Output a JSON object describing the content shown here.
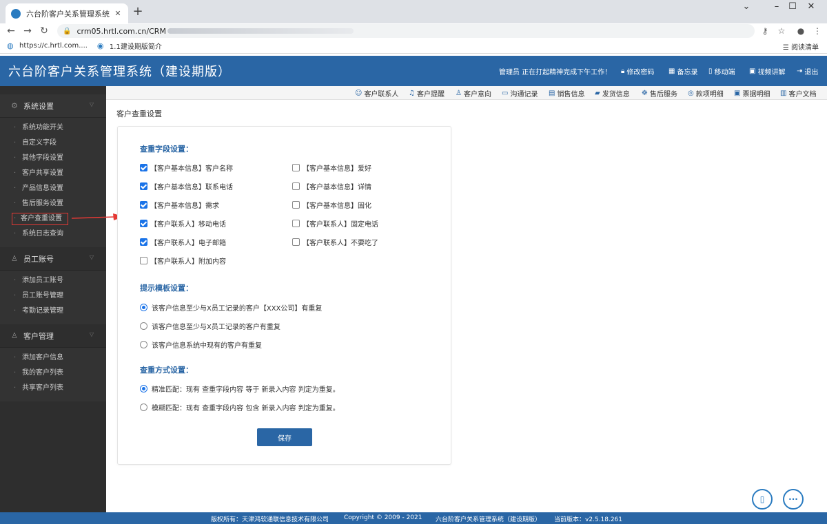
{
  "browser": {
    "tab_title": "六台阶客户关系管理系统（建设期",
    "url": "crm05.hrtl.com.cn/CRM",
    "bookmarks": [
      "https://c.hrtl.com....",
      "1.1建设期版简介"
    ],
    "reading_list": "阅读清单"
  },
  "header": {
    "title": "六台阶客户关系管理系统（建设期版）",
    "status": "管理员 正在打起精神完成下午工作！",
    "links": [
      "修改密码",
      "备忘录",
      "移动端",
      "视频讲解",
      "退出"
    ]
  },
  "sidebar": {
    "groups": [
      {
        "label": "系统设置",
        "items": [
          "系统功能开关",
          "自定义字段",
          "其他字段设置",
          "客户共享设置",
          "产品信息设置",
          "售后服务设置",
          "客户查重设置",
          "系统日志查询"
        ]
      },
      {
        "label": "员工账号",
        "items": [
          "添加员工账号",
          "员工账号管理",
          "考勤记录管理"
        ]
      },
      {
        "label": "客户管理",
        "items": [
          "添加客户信息",
          "我的客户列表",
          "共享客户列表"
        ]
      }
    ]
  },
  "shortcuts": [
    "客户联系人",
    "客户提醒",
    "客户意向",
    "沟通记录",
    "销售信息",
    "发货信息",
    "售后服务",
    "款项明细",
    "票据明细",
    "客户文档"
  ],
  "page_title": "客户查重设置",
  "dup_fields": {
    "title": "查重字段设置：",
    "options": [
      {
        "label": "【客户基本信息】客户名称",
        "checked": true
      },
      {
        "label": "【客户基本信息】爱好",
        "checked": false
      },
      {
        "label": "【客户基本信息】联系电话",
        "checked": true
      },
      {
        "label": "【客户基本信息】详情",
        "checked": false
      },
      {
        "label": "【客户基本信息】需求",
        "checked": true
      },
      {
        "label": "【客户基本信息】固化",
        "checked": false
      },
      {
        "label": "【客户联系人】移动电话",
        "checked": true
      },
      {
        "label": "【客户联系人】固定电话",
        "checked": false
      },
      {
        "label": "【客户联系人】电子邮箱",
        "checked": true
      },
      {
        "label": "【客户联系人】不要吃了",
        "checked": false
      },
      {
        "label": "【客户联系人】附加内容",
        "checked": false
      }
    ]
  },
  "prompt_template": {
    "title": "提示模板设置：",
    "options": [
      {
        "label": "该客户信息至少与X员工记录的客户【XXX公司】有重复",
        "selected": true
      },
      {
        "label": "该客户信息至少与X员工记录的客户有重复",
        "selected": false
      },
      {
        "label": "该客户信息系统中现有的客户有重复",
        "selected": false
      }
    ]
  },
  "match_mode": {
    "title": "查重方式设置：",
    "options": [
      {
        "label": "精准匹配：现有 查重字段内容 等于 新录入内容 判定为重复。",
        "selected": true
      },
      {
        "label": "模糊匹配：现有 查重字段内容 包含 新录入内容 判定为重复。",
        "selected": false
      }
    ]
  },
  "save_label": "保存",
  "footer": {
    "owner": "版权所有：天津鸿软通联信息技术有限公司",
    "copyright": "Copyright © 2009 - 2021",
    "system": "六台阶客户关系管理系统（建设期版）",
    "version": "当前版本：v2.5.18.261"
  },
  "colors": {
    "brand": "#2a66a5",
    "sidebar": "#2e2e2e",
    "check": "#1a73e8",
    "annotation": "#e53935"
  }
}
